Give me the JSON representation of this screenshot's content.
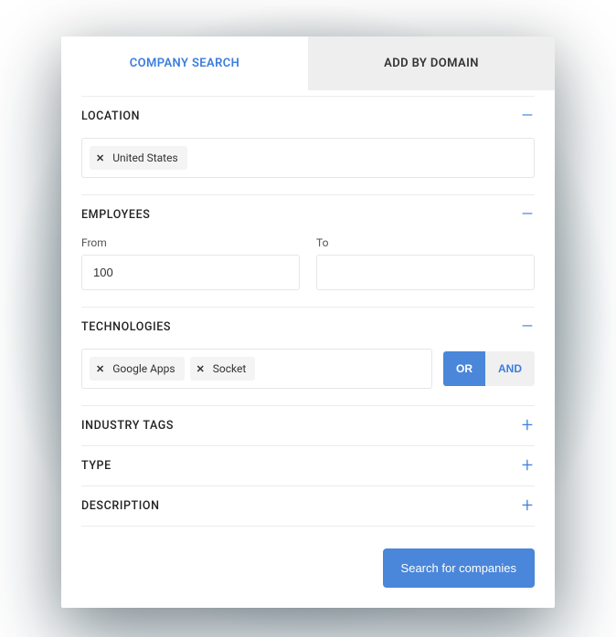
{
  "tabs": {
    "search": "COMPANY SEARCH",
    "add_domain": "ADD BY DOMAIN"
  },
  "sections": {
    "location": {
      "title": "LOCATION",
      "chips": [
        "United States"
      ]
    },
    "employees": {
      "title": "EMPLOYEES",
      "from_label": "From",
      "to_label": "To",
      "from_value": "100",
      "to_value": ""
    },
    "technologies": {
      "title": "TECHNOLOGIES",
      "chips": [
        "Google Apps",
        "Socket"
      ],
      "logic_or": "OR",
      "logic_and": "AND"
    },
    "industry_tags": {
      "title": "INDUSTRY TAGS"
    },
    "type": {
      "title": "TYPE"
    },
    "description": {
      "title": "DESCRIPTION"
    }
  },
  "icons": {
    "minus": "–",
    "plus": "+",
    "close": "✕"
  },
  "actions": {
    "search": "Search for companies"
  }
}
